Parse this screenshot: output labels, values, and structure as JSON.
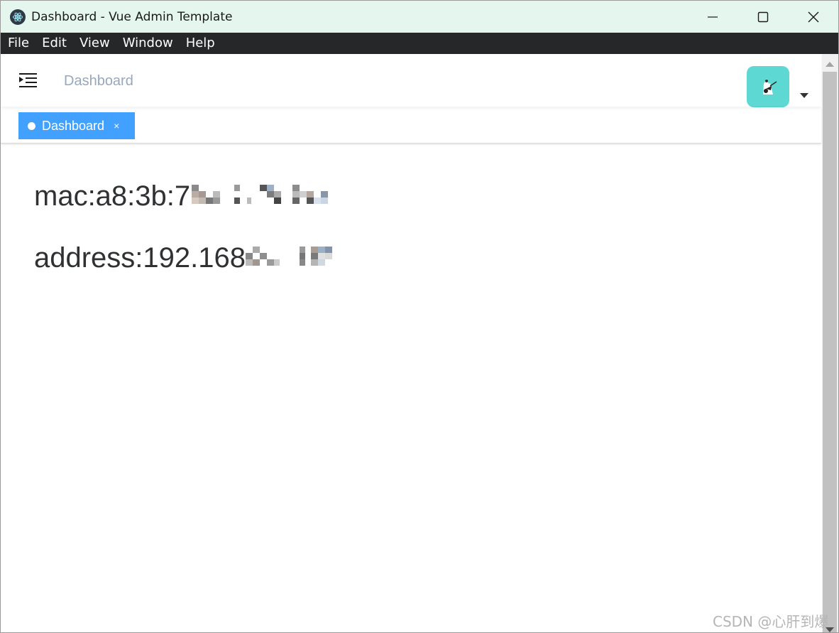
{
  "window": {
    "title": "Dashboard - Vue Admin Template"
  },
  "window_controls": [
    "minimize-icon",
    "maximize-icon",
    "close-icon"
  ],
  "menu": [
    {
      "label": "File"
    },
    {
      "label": "Edit"
    },
    {
      "label": "View"
    },
    {
      "label": "Window"
    },
    {
      "label": "Help"
    }
  ],
  "navbar": {
    "breadcrumb": "Dashboard",
    "hamburger_icon": "menu-fold-icon",
    "avatar_icon": "user-avatar",
    "dropdown_icon": "caret-down-icon"
  },
  "tags": [
    {
      "label": "Dashboard",
      "active": true,
      "close": "×"
    }
  ],
  "content": {
    "mac_visible": "mac:a8:3b:7",
    "address_visible": "address:192.168"
  },
  "colors": {
    "titlebar": "#e4f6ee",
    "menubar": "#262729",
    "active_tag": "#42a0ff",
    "breadcrumb_text": "#97a8be",
    "avatar_bg": "#5ed8d2",
    "body_text": "#303133"
  },
  "watermark": "CSDN @心肝到爆"
}
